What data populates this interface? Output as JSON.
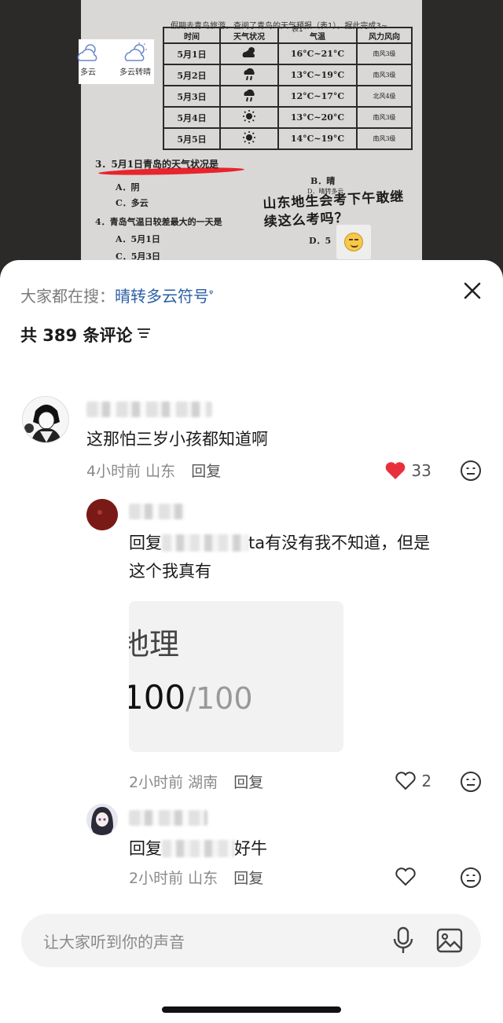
{
  "photo": {
    "paper_header": "…假期去青岛旅游，查阅了青岛的天气预报（表1），据此完成3~",
    "table_caption": "表1",
    "weather_table": {
      "headers": [
        "时间",
        "天气状况",
        "气温",
        "风力风向"
      ],
      "rows": [
        {
          "date": "5月1日",
          "icon": "cloud-sun-icon",
          "temp": "16°C~21°C",
          "wind": "南风3级"
        },
        {
          "date": "5月2日",
          "icon": "rain-cloud-icon",
          "temp": "13°C~19°C",
          "wind": "南风3级"
        },
        {
          "date": "5月3日",
          "icon": "rain-cloud-icon",
          "temp": "12°C~17°C",
          "wind": "北风4级"
        },
        {
          "date": "5月4日",
          "icon": "sun-icon",
          "temp": "13°C~20°C",
          "wind": "南风3级"
        },
        {
          "date": "5月5日",
          "icon": "sun-icon",
          "temp": "14°C~19°C",
          "wind": "南风3级"
        }
      ]
    },
    "q3": "3．5月1日青岛的天气状况是",
    "q3_a": "A．阴",
    "q3_b": "B．晴",
    "q3_c": "C．多云",
    "q3_d": "D．晴转多云",
    "q4": "4．青岛气温日较差最大的一天是",
    "q4_a": "A．5月1日",
    "q4_c": "C．5月3日",
    "q4_d": "D．5",
    "handwriting": "山东地生会考下午敢继续这么考吗？",
    "sticker": [
      {
        "label": "多云",
        "icon": "cloudy-icon"
      },
      {
        "label": "多云转晴",
        "icon": "cloudy-to-sunny-icon"
      }
    ],
    "emoji_sticker": "smile-emoji"
  },
  "sheet": {
    "search_prefix": "大家都在搜：",
    "search_link": "晴转多云符号",
    "comment_count": "共 389 条评论",
    "comments": [
      {
        "text": "这那怕三岁小孩都知道啊",
        "time": "4小时前",
        "location": "山东",
        "reply_label": "回复",
        "likes": "33",
        "liked": true
      }
    ],
    "replies": [
      {
        "text_prefix": "回复",
        "text_mid": "ta有没有我不知道，但是",
        "text_line2": "这个我真有",
        "image_subject": "地理",
        "image_score": "100",
        "image_score_total": "/100",
        "time": "2小时前",
        "location": "湖南",
        "reply_label": "回复",
        "likes": "2"
      },
      {
        "text_prefix": "回复",
        "text_suffix": "好牛",
        "time": "2小时前",
        "location": "山东",
        "reply_label": "回复",
        "likes": ""
      }
    ],
    "input_placeholder": "让大家听到你的声音"
  },
  "colors": {
    "accent_link": "#2a5fa5",
    "like_red": "#e8303d",
    "underline_red": "#e8242c"
  }
}
